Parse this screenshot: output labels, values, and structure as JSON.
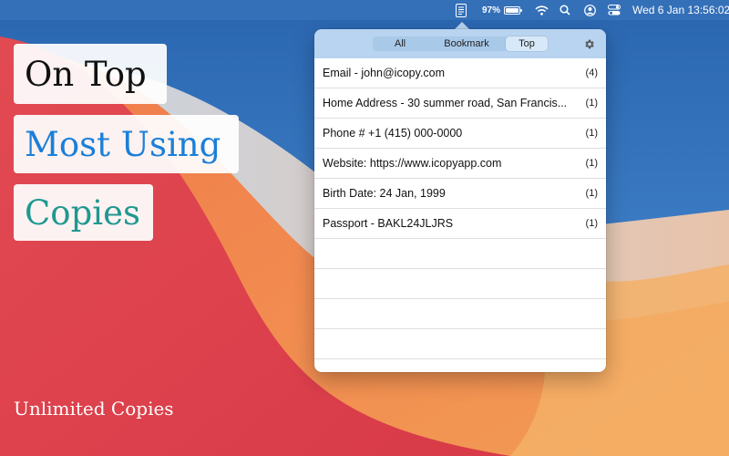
{
  "menubar": {
    "battery_percent": "97%",
    "battery_level": 0.97,
    "datetime": "Wed 6 Jan  13:56:02",
    "icons": [
      "icopy-icon",
      "battery-icon",
      "wifi-icon",
      "search-icon",
      "user-icon",
      "control-center-icon"
    ]
  },
  "taglines": {
    "line1": "On Top",
    "line2": "Most Using",
    "line3": "Copies",
    "footer": "Unlimited Copies"
  },
  "colors": {
    "tag_dark": "#111111",
    "tag_blue": "#1a7fd9",
    "tag_teal": "#1f9890",
    "popover_header": "#b8d4f0"
  },
  "popover": {
    "tabs": [
      {
        "label": "All",
        "selected": false
      },
      {
        "label": "Bookmark",
        "selected": false
      },
      {
        "label": "Top",
        "selected": true
      }
    ],
    "items": [
      {
        "text": "Email - john@icopy.com",
        "count": "(4)"
      },
      {
        "text": "Home Address - 30 summer road, San Francis...",
        "count": "(1)"
      },
      {
        "text": "Phone # +1 (415) 000-0000",
        "count": "(1)"
      },
      {
        "text": "Website: https://www.icopyapp.com",
        "count": "(1)"
      },
      {
        "text": "Birth Date: 24 Jan, 1999",
        "count": "(1)"
      },
      {
        "text": "Passport - BAKL24JLJRS",
        "count": "(1)"
      }
    ]
  }
}
